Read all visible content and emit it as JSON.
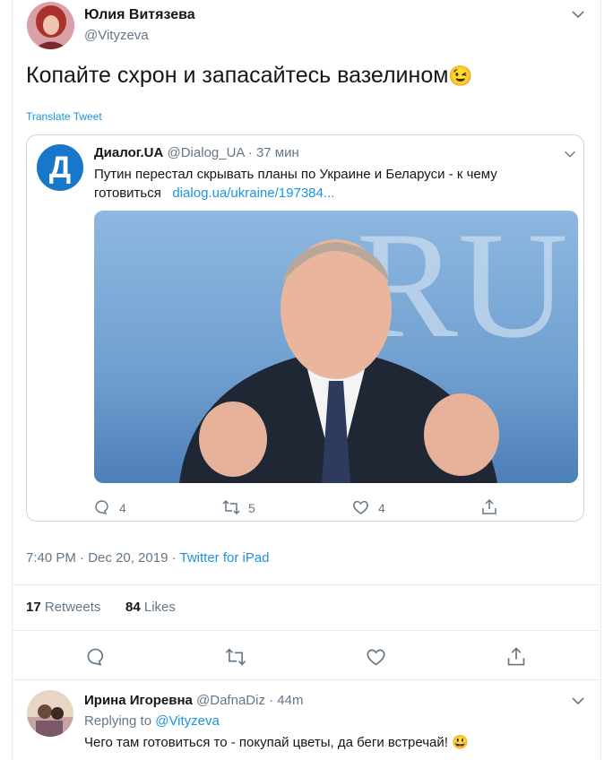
{
  "tweet": {
    "author_name": "Юлия Витязева",
    "author_handle": "@Vityzeva",
    "text": "Копайте схрон и запасайтесь вазелином",
    "emoji": "😉",
    "translate_label": "Translate Tweet",
    "timestamp": "7:40 PM · Dec 20, 2019 · ",
    "source": "Twitter for iPad",
    "retweets_count": "17",
    "retweets_label": "Retweets",
    "likes_count": "84",
    "likes_label": "Likes"
  },
  "quoted": {
    "avatar_letter": "Д",
    "author_name": "Диалог.UA",
    "author_handle": "@Dialog_UA",
    "time": "· 37 мин",
    "text": "Путин перестал скрывать планы по Украине и Беларуси - к чему готовиться",
    "link": "dialog.ua/ukraine/197384...",
    "image_bg_text": ".RU",
    "replies": "4",
    "retweets": "5",
    "likes": "4"
  },
  "reply": {
    "author_name": "Ирина Игоревна",
    "author_handle": "@DafnaDiz",
    "time": "· 44m",
    "replying_prefix": "Replying to ",
    "replying_to": "@Vityzeva",
    "text": "Чего там готовиться то - покупай цветы, да беги встречай!",
    "emoji": "😃"
  },
  "colors": {
    "accent": "#1b95e0",
    "muted": "#657786",
    "dialog_brand": "#1877c9"
  }
}
